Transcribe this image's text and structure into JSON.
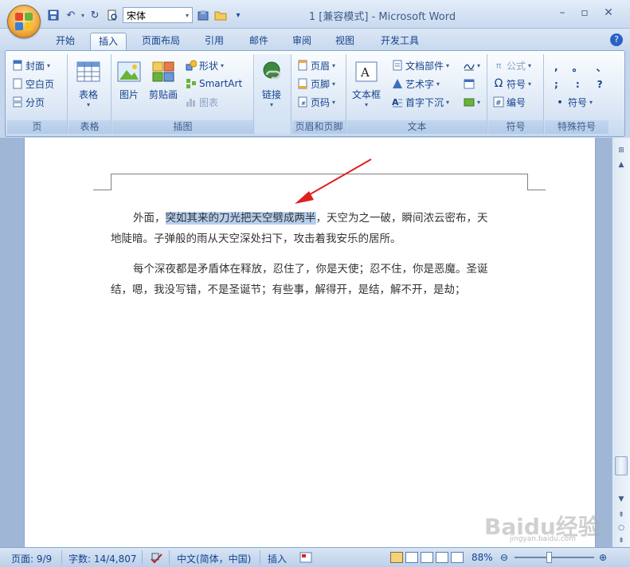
{
  "window": {
    "title": "1 [兼容模式] - Microsoft Word",
    "font_name": "宋体"
  },
  "tabs": [
    "开始",
    "插入",
    "页面布局",
    "引用",
    "邮件",
    "审阅",
    "视图",
    "开发工具"
  ],
  "active_tab": "插入",
  "ribbon": {
    "pages": {
      "label": "页",
      "items": [
        "封面",
        "空白页",
        "分页"
      ]
    },
    "tables": {
      "label": "表格",
      "button": "表格"
    },
    "illustrations": {
      "label": "插图",
      "picture": "图片",
      "clipart": "剪贴画",
      "shapes": "形状",
      "smartart": "SmartArt",
      "chart": "图表"
    },
    "links": {
      "label": "",
      "button": "链接"
    },
    "header_footer": {
      "label": "页眉和页脚",
      "items": [
        "页眉",
        "页脚",
        "页码"
      ]
    },
    "text": {
      "label": "文本",
      "textbox": "文本框",
      "quickparts": "文档部件",
      "wordart": "艺术字",
      "dropcap": "首字下沉"
    },
    "symbols": {
      "label": "符号",
      "equation": "公式",
      "symbol": "符号",
      "number": "编号"
    },
    "special": {
      "label": "特殊符号",
      "chars": [
        ",",
        "。",
        "、",
        ";",
        ":",
        "?"
      ],
      "symbol": "符号"
    }
  },
  "document": {
    "p1_before": "外面，",
    "p1_selected": "突如其来的刀光把天空劈成两半",
    "p1_after": "，天空为之一破，瞬间浓云密布，天",
    "p1_line2": "地陡暗。子弹般的雨从天空深处扫下，攻击着我安乐的居所。",
    "p2_line1": "每个深夜都是矛盾体在释放，忍住了，你是天使；忍不住，你是恶魔。圣诞",
    "p2_line2": "结，嗯，我没写错，不是圣诞节；有些事，解得开，是结，解不开，是劫；"
  },
  "status": {
    "page": "页面: 9/9",
    "words": "字数: 14/4,807",
    "language": "中文(简体，中国)",
    "mode": "插入",
    "zoom": "88%"
  },
  "watermark": {
    "text": "Baidu经验",
    "sub": "jingyan.baidu.com"
  }
}
